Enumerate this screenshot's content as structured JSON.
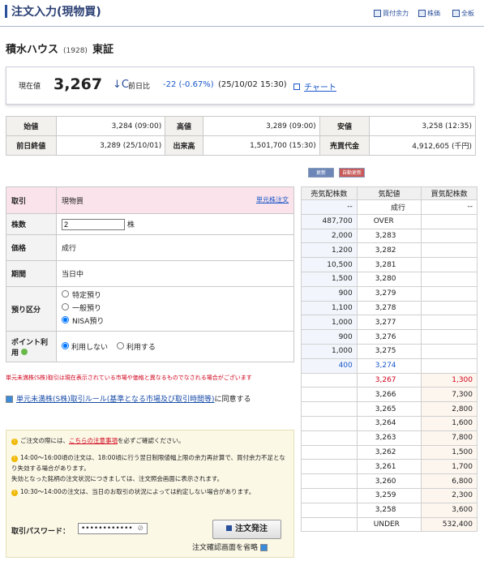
{
  "header": {
    "title": "注文入力(現物買)",
    "links": [
      "買付余力",
      "株価",
      "全板"
    ]
  },
  "stock": {
    "name": "積水ハウス",
    "code": "(1928)",
    "market": "東証"
  },
  "price": {
    "label": "現在値",
    "value": "3,267",
    "indicator": "↓C",
    "change_label": "前日比",
    "change": "-22 (-0.67%)",
    "datetime": "(25/10/02 15:30)",
    "chart_link": "チャート"
  },
  "quote_rows": [
    [
      {
        "h": "始値"
      },
      {
        "v": "3,284 (09:00)"
      },
      {
        "h": "高値"
      },
      {
        "v": "3,289 (09:00)"
      },
      {
        "h": "安値"
      },
      {
        "v": "3,258 (12:35)"
      }
    ],
    [
      {
        "h": "前日終値"
      },
      {
        "v": "3,289 (25/10/01)"
      },
      {
        "h": "出来高"
      },
      {
        "v": "1,501,700 (15:30)"
      },
      {
        "h": "売買代金"
      },
      {
        "v": "4,912,605 (千円)"
      }
    ]
  ],
  "buttons": {
    "refresh": "更新",
    "auto_off": "自動更新 OFF"
  },
  "order": {
    "torihiki_label": "取引",
    "torihiki_value": "現物買",
    "tangen_link": "単元株注文",
    "qty_label": "株数",
    "qty_value": "2",
    "qty_unit": "株",
    "price_label": "価格",
    "price_value": "成行",
    "period_label": "期間",
    "period_value": "当日中",
    "account_label": "預り区分",
    "account_options": [
      "特定預り",
      "一般預り",
      "NISA預り"
    ],
    "point_label": "ポイント利用",
    "point_options": [
      "利用しない",
      "利用する"
    ]
  },
  "note": "単元未満株(S株)取引は現在表示されている市場や価格と異なるものでなされる場合がございます",
  "agree": {
    "link": "単元未満株(S株)取引ルール(基準となる市場及び取引時間等)",
    "suffix": "に同意する"
  },
  "info": {
    "line1_pre": "ご注文の際には、",
    "line1_link": "こちらの注意事項",
    "line1_post": "を必ずご確認ください。",
    "line2": "14:00～16:00頃の注文は、18:00頃に行う翌日制限値幅上限の余力再計算で、買付余力不足となり失効する場合があります。",
    "line3": "失効となった銘柄の注文状況につきましては、注文照会画面に表示されます。",
    "line4": "10:30～14:00の注文は、当日のお取引の状況によっては約定しない場合があります。"
  },
  "password": {
    "label": "取引パスワード：",
    "masked": "••••••••••••"
  },
  "submit_label": "注文発注",
  "skip_label": "注文確認画面を省略",
  "book": {
    "headers": [
      "売気配株数",
      "気配値",
      "買気配株数"
    ],
    "rows": [
      [
        "--",
        "成行",
        "--"
      ],
      [
        "487,700",
        "OVER",
        ""
      ],
      [
        "2,000",
        "3,283",
        ""
      ],
      [
        "1,200",
        "3,282",
        ""
      ],
      [
        "10,500",
        "3,281",
        ""
      ],
      [
        "1,500",
        "3,280",
        ""
      ],
      [
        "900",
        "3,279",
        ""
      ],
      [
        "1,100",
        "3,278",
        ""
      ],
      [
        "1,000",
        "3,277",
        ""
      ],
      [
        "900",
        "3,276",
        ""
      ],
      [
        "1,000",
        "3,275",
        ""
      ],
      [
        "400",
        "3,274",
        ""
      ],
      [
        "",
        "3,267",
        "1,300"
      ],
      [
        "",
        "3,266",
        "7,300"
      ],
      [
        "",
        "3,265",
        "2,800"
      ],
      [
        "",
        "3,264",
        "1,600"
      ],
      [
        "",
        "3,263",
        "7,800"
      ],
      [
        "",
        "3,262",
        "1,500"
      ],
      [
        "",
        "3,261",
        "1,700"
      ],
      [
        "",
        "3,260",
        "6,800"
      ],
      [
        "",
        "3,259",
        "2,300"
      ],
      [
        "",
        "3,258",
        "3,600"
      ],
      [
        "",
        "UNDER",
        "532,400"
      ]
    ]
  }
}
